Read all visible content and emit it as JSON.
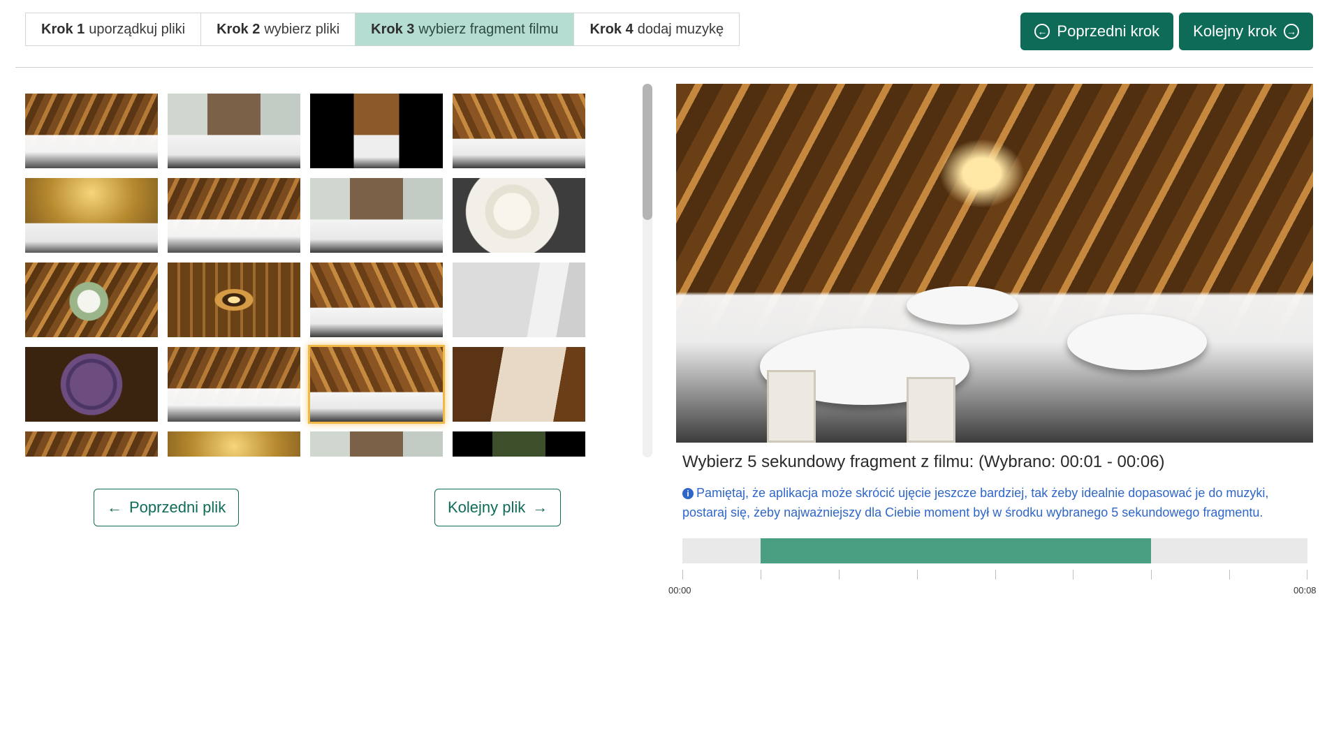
{
  "steps": [
    {
      "num": "Krok 1",
      "label": "uporządkuj pliki",
      "active": false
    },
    {
      "num": "Krok 2",
      "label": "wybierz pliki",
      "active": false
    },
    {
      "num": "Krok 3",
      "label": "wybierz fragment filmu",
      "active": true
    },
    {
      "num": "Krok 4",
      "label": "dodaj muzykę",
      "active": false
    }
  ],
  "top_nav": {
    "prev_label": "Poprzedni krok",
    "prev_icon": "arrow-circle-left-icon",
    "next_label": "Kolejny krok",
    "next_icon": "arrow-circle-right-icon"
  },
  "thumbnails": {
    "selected_index": 14,
    "items": [
      "barn-hall",
      "table-setting",
      "letterboxed-hall",
      "chairs-table",
      "golden-hall",
      "hall-guests",
      "window-tables",
      "plate-closeup",
      "flower-centerpiece",
      "wheel-chandelier",
      "hall-tables",
      "name-card",
      "wheel-ceiling",
      "hall-wide",
      "hall-selected",
      "seating-plan",
      "partial-1",
      "partial-2",
      "partial-3",
      "partial-4"
    ]
  },
  "file_nav": {
    "prev_label": "Poprzedni plik",
    "next_label": "Kolejny plik"
  },
  "preview": {
    "caption": "Wybierz 5 sekundowy fragment z filmu: (Wybrano: 00:01 - 00:06)",
    "info": "Pamiętaj, że aplikacja może skrócić ujęcie jeszcze bardziej, tak żeby idealnie dopasować je do muzyki, postaraj się, żeby najważniejszy dla Ciebie moment był w środku wybranego 5 sekundowego fragmentu.",
    "info_icon": "info-circle-icon"
  },
  "timeline": {
    "duration_seconds": 8,
    "selection_start_seconds": 1,
    "selection_end_seconds": 6,
    "start_label": "00:00",
    "end_label": "00:08",
    "selected_color": "#4a9f83"
  },
  "colors": {
    "primary": "#0e6b58",
    "active_tab": "#b6ddd2",
    "info_text": "#2e66c9",
    "selected_thumb": "#f2b846"
  }
}
